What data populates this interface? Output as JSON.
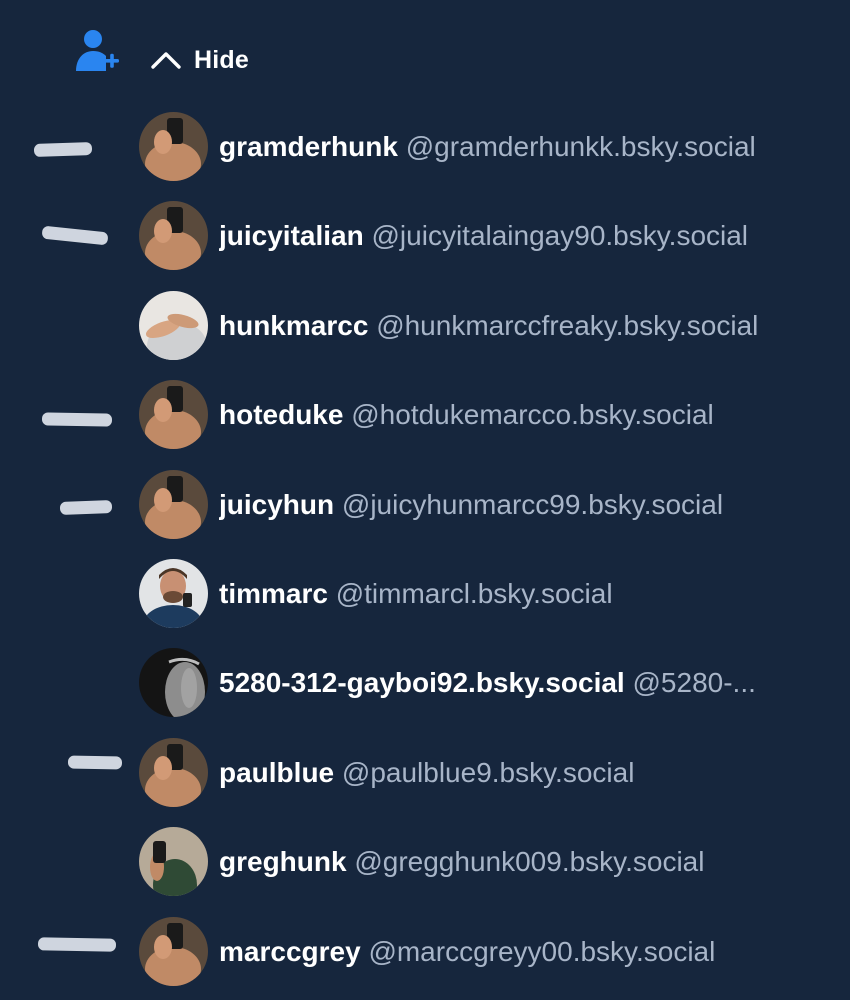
{
  "header": {
    "hide_label": "Hide",
    "follow_icon": "person-plus-icon",
    "chevron_icon": "chevron-up-icon",
    "accent_color": "#2a85f0"
  },
  "users": [
    {
      "name": "gramderhunk",
      "handle": "@gramderhunkk.bsky.social",
      "avatar": "mirror-selfie-photo"
    },
    {
      "name": "juicyitalian",
      "handle": "@juicyitalaingay90.bsky.social",
      "avatar": "mirror-selfie-photo"
    },
    {
      "name": "hunkmarcc",
      "handle": "@hunkmarccfreaky.bsky.social",
      "avatar": "white-shirt-photo"
    },
    {
      "name": "hoteduke",
      "handle": "@hotdukemarcco.bsky.social",
      "avatar": "mirror-selfie-photo"
    },
    {
      "name": "juicyhun",
      "handle": "@juicyhunmarcc99.bsky.social",
      "avatar": "mirror-selfie-photo"
    },
    {
      "name": "timmarc",
      "handle": "@timmarcl.bsky.social",
      "avatar": "bearded-man-photo"
    },
    {
      "name": "5280-312-gayboi92.bsky.social",
      "handle": "@5280-...",
      "avatar": "grey-sweatpants-photo"
    },
    {
      "name": "paulblue",
      "handle": "@paulblue9.bsky.social",
      "avatar": "mirror-selfie-photo"
    },
    {
      "name": "greghunk",
      "handle": "@gregghunk009.bsky.social",
      "avatar": "green-tanktop-photo"
    },
    {
      "name": "marccgrey",
      "handle": "@marccgreyy00.bsky.social",
      "avatar": "mirror-selfie-photo"
    }
  ],
  "colors": {
    "background": "#16263d",
    "name": "#ffffff",
    "handle": "#a8b5c8"
  }
}
